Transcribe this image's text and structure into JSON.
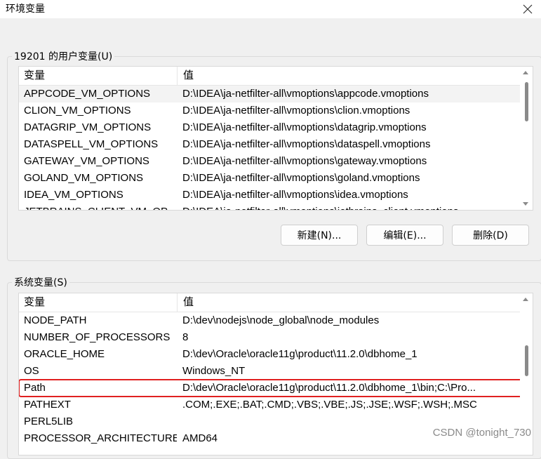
{
  "window": {
    "title": "环境变量"
  },
  "user_vars": {
    "group_title": "19201 的用户变量(U)",
    "columns": {
      "name": "变量",
      "value": "值"
    },
    "rows": [
      {
        "name": "APPCODE_VM_OPTIONS",
        "value": "D:\\IDEA\\ja-netfilter-all\\vmoptions\\appcode.vmoptions"
      },
      {
        "name": "CLION_VM_OPTIONS",
        "value": "D:\\IDEA\\ja-netfilter-all\\vmoptions\\clion.vmoptions"
      },
      {
        "name": "DATAGRIP_VM_OPTIONS",
        "value": "D:\\IDEA\\ja-netfilter-all\\vmoptions\\datagrip.vmoptions"
      },
      {
        "name": "DATASPELL_VM_OPTIONS",
        "value": "D:\\IDEA\\ja-netfilter-all\\vmoptions\\dataspell.vmoptions"
      },
      {
        "name": "GATEWAY_VM_OPTIONS",
        "value": "D:\\IDEA\\ja-netfilter-all\\vmoptions\\gateway.vmoptions"
      },
      {
        "name": "GOLAND_VM_OPTIONS",
        "value": "D:\\IDEA\\ja-netfilter-all\\vmoptions\\goland.vmoptions"
      },
      {
        "name": "IDEA_VM_OPTIONS",
        "value": "D:\\IDEA\\ja-netfilter-all\\vmoptions\\idea.vmoptions"
      },
      {
        "name": "JETBRAINS_CLIENT_VM_OP",
        "value": "D:\\IDEA\\ja-netfilter-all\\vmoptions\\jetbrains_client.vmoptions"
      }
    ],
    "buttons": {
      "new": "新建(N)...",
      "edit": "编辑(E)...",
      "delete": "删除(D)"
    }
  },
  "system_vars": {
    "group_title": "系统变量(S)",
    "columns": {
      "name": "变量",
      "value": "值"
    },
    "rows": [
      {
        "name": "NODE_PATH",
        "value": "D:\\dev\\nodejs\\node_global\\node_modules"
      },
      {
        "name": "NUMBER_OF_PROCESSORS",
        "value": "8"
      },
      {
        "name": "ORACLE_HOME",
        "value": "D:\\dev\\Oracle\\oracle11g\\product\\11.2.0\\dbhome_1"
      },
      {
        "name": "OS",
        "value": "Windows_NT"
      },
      {
        "name": "Path",
        "value": "D:\\dev\\Oracle\\oracle11g\\product\\11.2.0\\dbhome_1\\bin;C:\\Pro..."
      },
      {
        "name": "PATHEXT",
        "value": ".COM;.EXE;.BAT;.CMD;.VBS;.VBE;.JS;.JSE;.WSF;.WSH;.MSC"
      },
      {
        "name": "PERL5LIB",
        "value": ""
      },
      {
        "name": "PROCESSOR_ARCHITECTURE",
        "value": "AMD64"
      }
    ]
  },
  "watermark": "CSDN @tonight_730",
  "colors": {
    "highlight_box": "#e02020",
    "selected_row": "#f3f3f3"
  }
}
